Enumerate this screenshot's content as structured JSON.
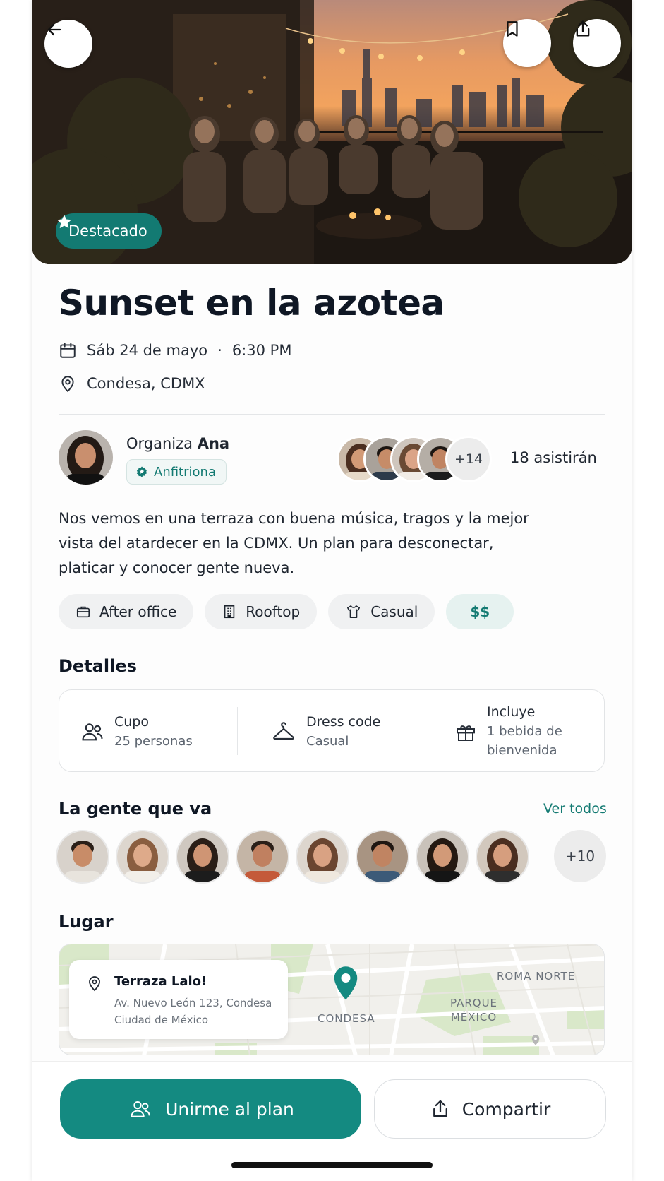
{
  "hero": {
    "featured_label": "Destacado"
  },
  "event": {
    "title": "Sunset en la azotea",
    "date": "Sáb 24 de mayo",
    "separator": "·",
    "time": "6:30 PM",
    "location": "Condesa, CDMX"
  },
  "host": {
    "prefix": "Organiza",
    "name": "Ana",
    "badge": "Anfitriona",
    "extra_count": "+14",
    "attending_text": "18 asistirán"
  },
  "description": "Nos vemos en una terraza con buena música, tragos y la mejor vista del atardecer en la CDMX. Un plan para desconectar, platicar y conocer gente nueva.",
  "tags": [
    {
      "label": "After office",
      "icon": "briefcase-icon"
    },
    {
      "label": "Rooftop",
      "icon": "building-icon"
    },
    {
      "label": "Casual",
      "icon": "shirt-icon"
    },
    {
      "label": "$$",
      "icon": ""
    }
  ],
  "details": {
    "heading": "Detalles",
    "items": [
      {
        "label": "Cupo",
        "value": "25 personas",
        "icon": "people-icon"
      },
      {
        "label": "Dress code",
        "value": "Casual",
        "icon": "hanger-icon"
      },
      {
        "label": "Incluye",
        "value": "1 bebida de bienvenida",
        "value_line1": "1 bebida de",
        "value_line2": "bienvenida",
        "icon": "gift-icon"
      }
    ]
  },
  "people": {
    "heading": "La gente que va",
    "see_all": "Ver todos",
    "more": "+10"
  },
  "place": {
    "heading": "Lugar",
    "venue": "Terraza Lalo!",
    "address_line1": "Av. Nuevo León 123, Condesa",
    "address_line2": "Ciudad de México",
    "map_labels": {
      "condesa": "CONDESA",
      "roma_norte": "ROMA NORTE",
      "parque_line1": "PARQUE",
      "parque_line2": "MÉXICO"
    }
  },
  "actions": {
    "join": "Unirme al plan",
    "share": "Compartir"
  },
  "colors": {
    "accent": "#148a81",
    "accent_dark": "#137a72"
  }
}
